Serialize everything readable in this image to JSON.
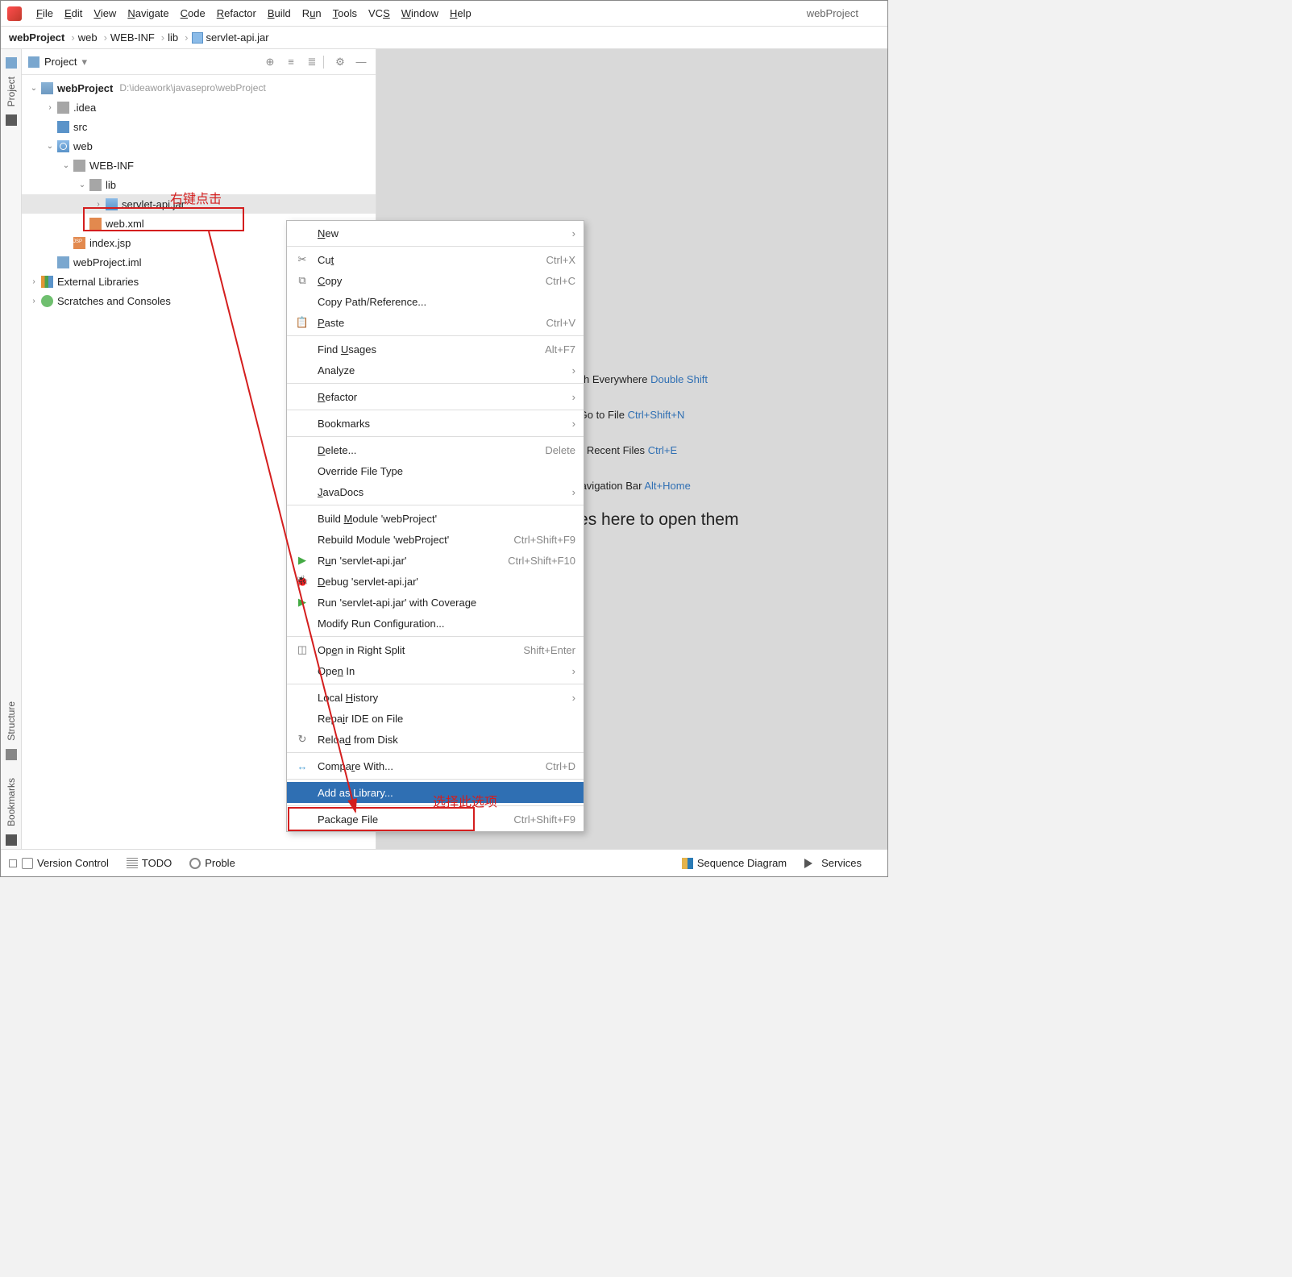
{
  "window_title": "webProject",
  "menubar": [
    "File",
    "Edit",
    "View",
    "Navigate",
    "Code",
    "Refactor",
    "Build",
    "Run",
    "Tools",
    "VCS",
    "Window",
    "Help"
  ],
  "breadcrumb": [
    "webProject",
    "web",
    "WEB-INF",
    "lib",
    "servlet-api.jar"
  ],
  "project_panel": {
    "title": "Project"
  },
  "tree": {
    "root": {
      "name": "webProject",
      "path": "D:\\ideawork\\javasepro\\webProject"
    },
    "idea": ".idea",
    "src": "src",
    "web": "web",
    "webinf": "WEB-INF",
    "lib": "lib",
    "jar": "servlet-api.jar",
    "webxml": "web.xml",
    "jsp": "index.jsp",
    "iml": "webProject.iml",
    "ext": "External Libraries",
    "scr": "Scratches and Consoles"
  },
  "annotation": {
    "right_click": "右键点击",
    "select_this": "选择此选项"
  },
  "hints": {
    "search": "Search Everywhere ",
    "search_kb": "Double Shift",
    "goto": "Go to File ",
    "goto_kb": "Ctrl+Shift+N",
    "recent": "Recent Files ",
    "recent_kb": "Ctrl+E",
    "nav": "Navigation Bar ",
    "nav_kb": "Alt+Home",
    "drop": "Drop files here to open them"
  },
  "context": {
    "new": "New",
    "cut": {
      "l": "Cut",
      "s": "Ctrl+X"
    },
    "copy": {
      "l": "Copy",
      "s": "Ctrl+C"
    },
    "copyref": "Copy Path/Reference...",
    "paste": {
      "l": "Paste",
      "s": "Ctrl+V"
    },
    "findu": {
      "l": "Find Usages",
      "s": "Alt+F7"
    },
    "analyze": "Analyze",
    "refactor": "Refactor",
    "bookmarks": "Bookmarks",
    "delete": {
      "l": "Delete...",
      "s": "Delete"
    },
    "override": "Override File Type",
    "javadocs": "JavaDocs",
    "buildm": "Build Module 'webProject'",
    "rebuildm": {
      "l": "Rebuild Module 'webProject'",
      "s": "Ctrl+Shift+F9"
    },
    "run": {
      "l": "Run 'servlet-api.jar'",
      "s": "Ctrl+Shift+F10"
    },
    "debug": "Debug 'servlet-api.jar'",
    "cov": "Run 'servlet-api.jar' with Coverage",
    "modrun": "Modify Run Configuration...",
    "split": {
      "l": "Open in Right Split",
      "s": "Shift+Enter"
    },
    "openin": "Open In",
    "localh": "Local History",
    "repair": "Repair IDE on File",
    "reload": "Reload from Disk",
    "compare": {
      "l": "Compare With...",
      "s": "Ctrl+D"
    },
    "addlib": "Add as Library...",
    "package": {
      "l": "Package File",
      "s": "Ctrl+Shift+F9"
    }
  },
  "sidebar": {
    "project": "Project",
    "structure": "Structure",
    "bookmarks": "Bookmarks"
  },
  "status": {
    "vc": "Version Control",
    "todo": "TODO",
    "problems": "Proble",
    "seq": "Sequence Diagram",
    "svc": "Services"
  }
}
